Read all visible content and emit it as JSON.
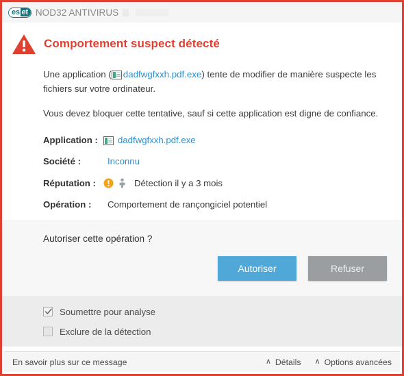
{
  "window": {
    "border_color": "#E0402F",
    "titlebar": {
      "logo_es": "es",
      "logo_et": "et",
      "product_name": "NOD32 ANTIVIRUS"
    }
  },
  "alert": {
    "icon": "warning-triangle-icon",
    "title": "Comportement suspect détecté",
    "title_color": "#E0402F",
    "paragraph_1_pre": "Une application (",
    "paragraph_1_link": "dadfwgfxxh.pdf.exe",
    "paragraph_1_post": ") tente de modifier de manière suspecte les fichiers sur votre ordinateur.",
    "paragraph_2": "Vous devez bloquer cette tentative, sauf si cette application est digne de confiance."
  },
  "details": [
    {
      "label": "Application :",
      "value": "dadfwgfxxh.pdf.exe",
      "kind": "link-with-icon"
    },
    {
      "label": "Société :",
      "value": "Inconnu",
      "kind": "link"
    },
    {
      "label": "Réputation :",
      "value": "Détection il y a 3 mois",
      "kind": "reputation"
    },
    {
      "label": "Opération :",
      "value": "Comportement de rançongiciel potentiel",
      "kind": "text"
    }
  ],
  "prompt": {
    "question": "Autoriser cette opération ?",
    "allow_label": "Autoriser",
    "deny_label": "Refuser",
    "allow_color": "#4FA8D8",
    "deny_color": "#9A9EA1"
  },
  "options": [
    {
      "label": "Soumettre pour analyse",
      "checked": true
    },
    {
      "label": "Exclure de la détection",
      "checked": false
    }
  ],
  "footer": {
    "more_info": "En savoir plus sur ce message",
    "details_label": "Détails",
    "advanced_label": "Options avancées",
    "chevron": "∧"
  }
}
